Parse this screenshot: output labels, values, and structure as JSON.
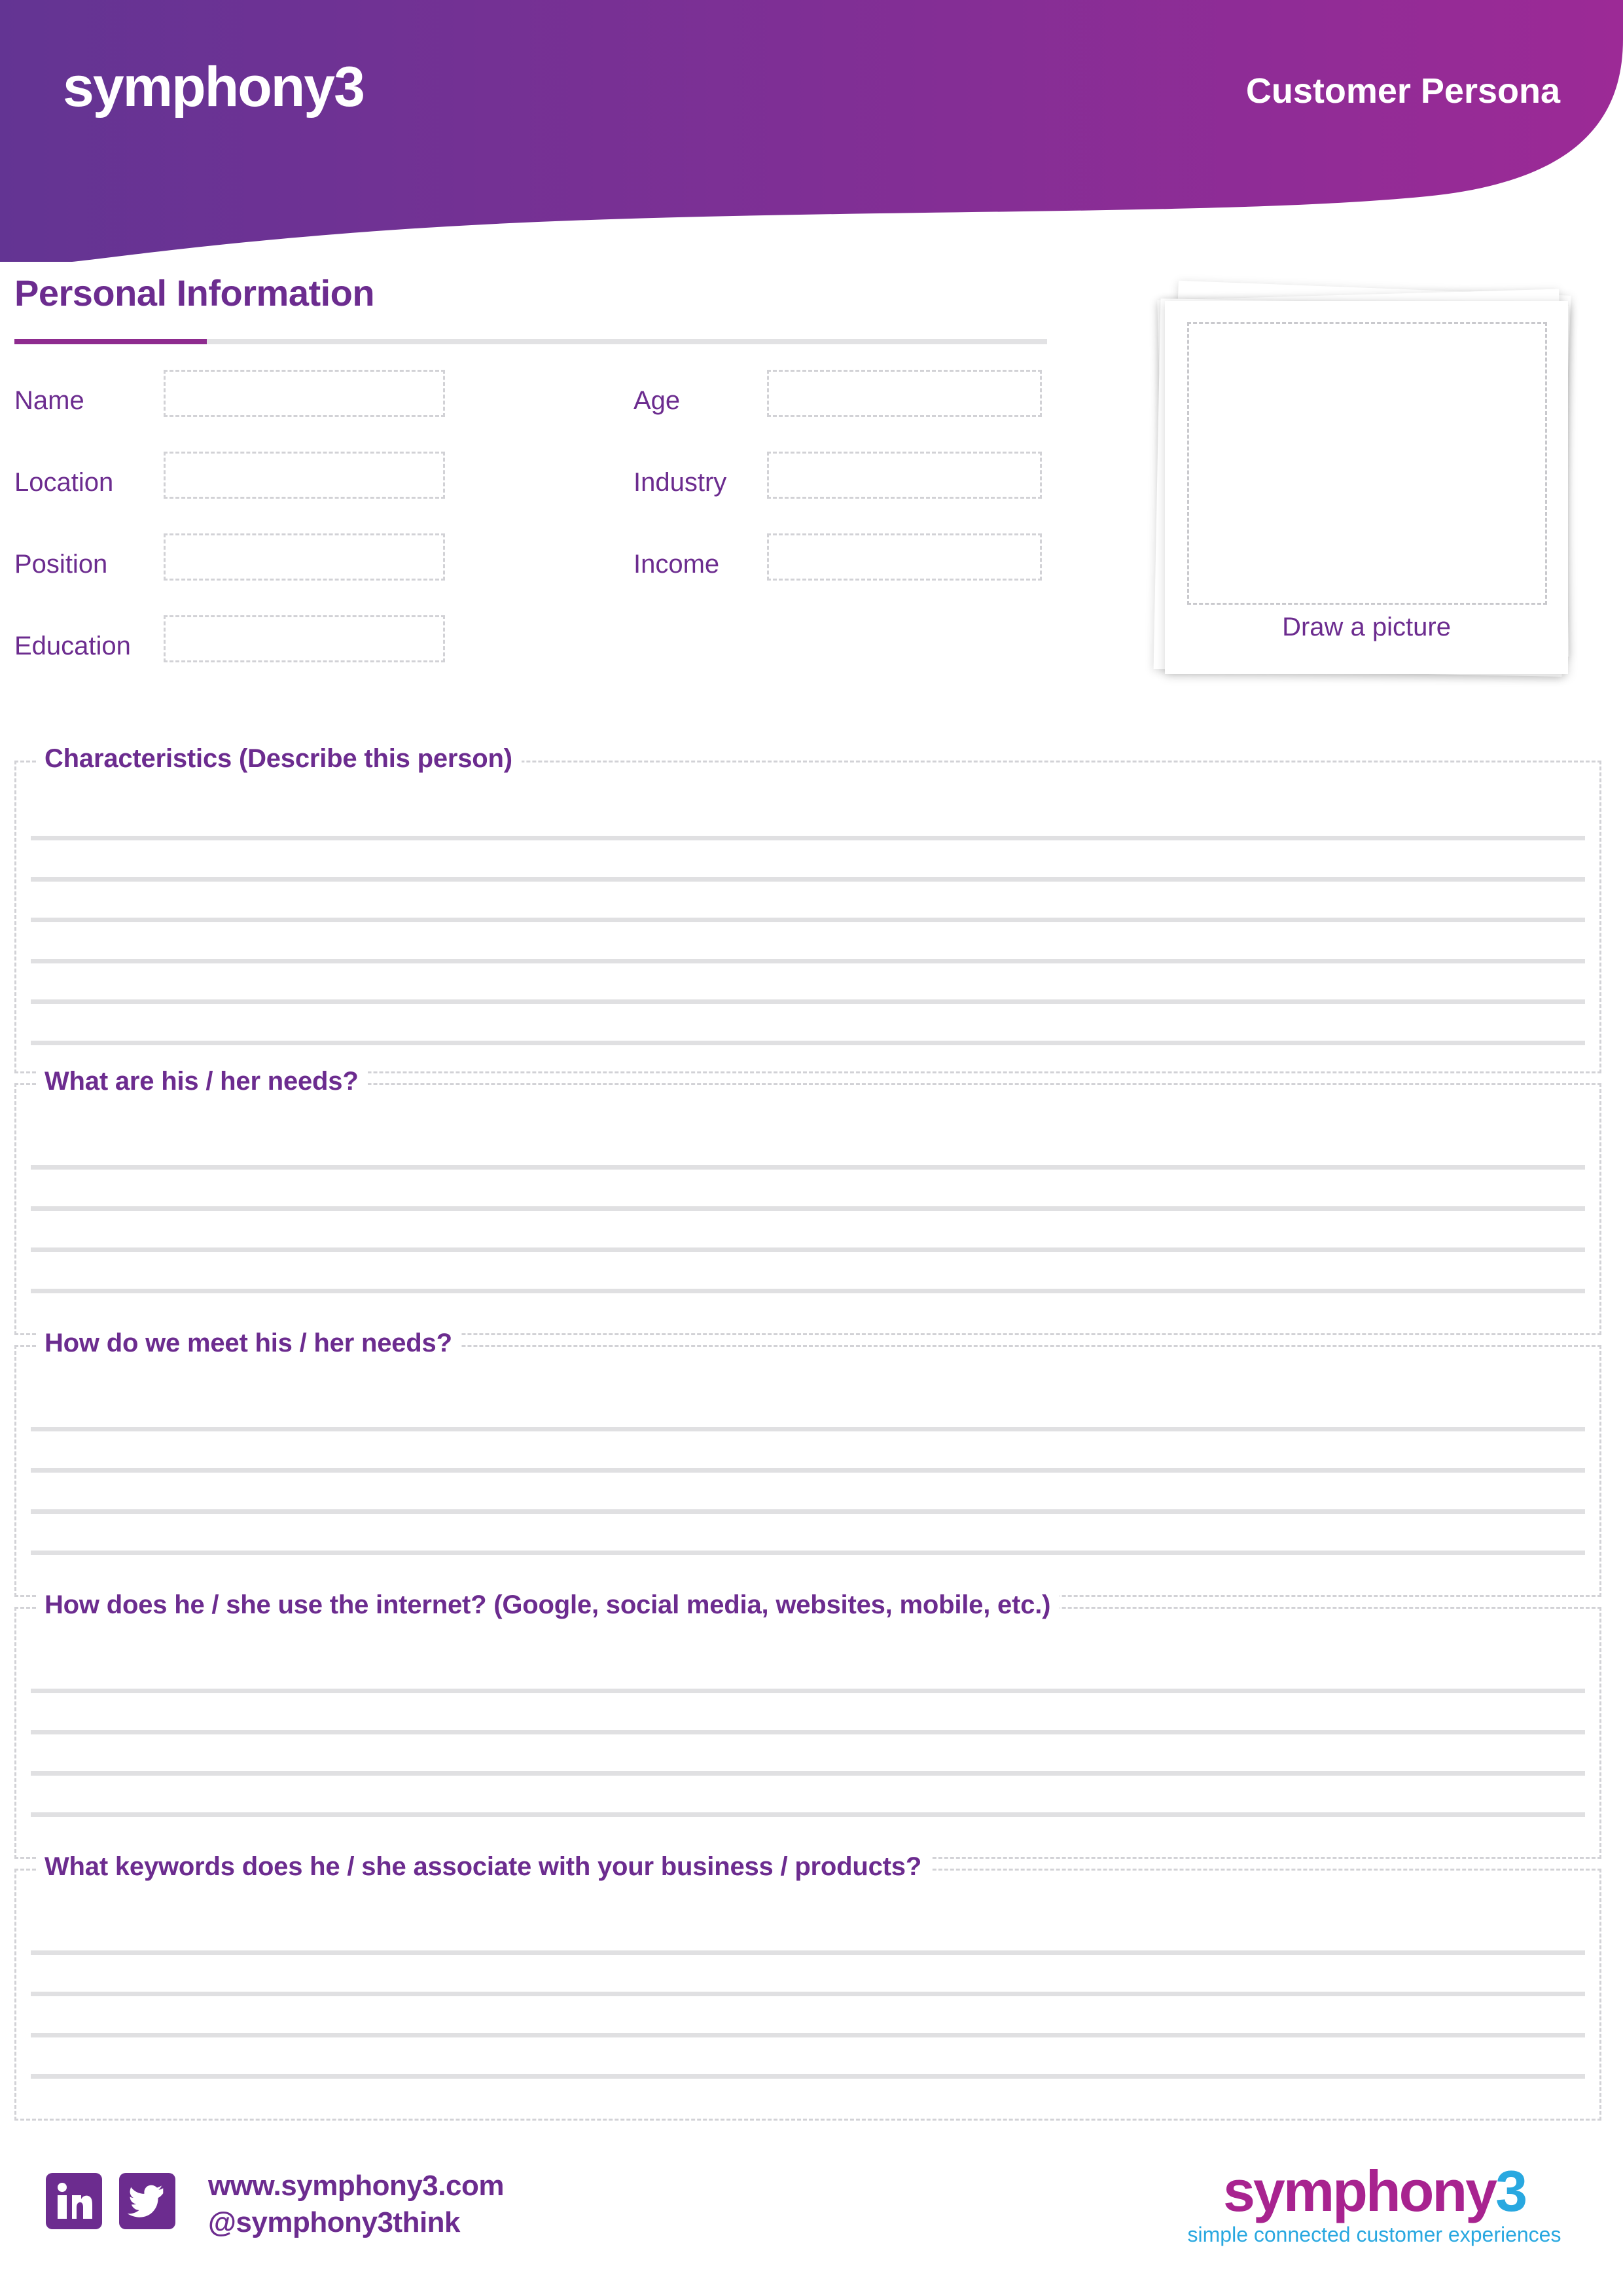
{
  "brand": {
    "header_logo": "symphony3",
    "header_title": "Customer Persona"
  },
  "colors": {
    "header_gradient_start": "#633493",
    "header_gradient_end": "#9c2a96",
    "purple_text": "#6c2c8f",
    "accent_underline": "#8e2b8f",
    "rule_gray": "#e0e0e2",
    "dashed_gray": "#d2d2d6",
    "logo_magenta": "#a8238f",
    "logo_cyan": "#29a8e0"
  },
  "personal_information": {
    "title": "Personal Information",
    "fields": [
      {
        "label": "Name",
        "value": ""
      },
      {
        "label": "Age",
        "value": ""
      },
      {
        "label": "Location",
        "value": ""
      },
      {
        "label": "Industry",
        "value": ""
      },
      {
        "label": "Position",
        "value": ""
      },
      {
        "label": "Income",
        "value": ""
      },
      {
        "label": "Education",
        "value": ""
      }
    ]
  },
  "picture_card": {
    "caption": "Draw a picture"
  },
  "questions": [
    {
      "heading": "Characteristics (Describe this person)",
      "lines": 6
    },
    {
      "heading": "What are his / her needs?",
      "lines": 4
    },
    {
      "heading": "How do we meet his / her needs?",
      "lines": 4
    },
    {
      "heading": "How does he / she use the internet? (Google, social media, websites, mobile, etc.)",
      "lines": 4
    },
    {
      "heading": "What keywords does he / she associate with your business / products?",
      "lines": 4
    }
  ],
  "footer": {
    "website": "www.symphony3.com",
    "twitter_handle": "@symphony3think",
    "logo_word": "symphony",
    "logo_numeral": "3",
    "tagline": "simple connected customer experiences",
    "social": [
      {
        "name": "linkedin",
        "label": "in"
      },
      {
        "name": "twitter",
        "label": "bird"
      }
    ]
  }
}
